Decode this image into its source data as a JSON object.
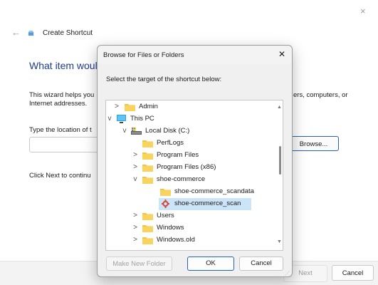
{
  "wizard": {
    "title": "Create Shortcut",
    "heading": "What item woul",
    "description_line1": "This wizard helps you",
    "description_line2": "Internet addresses.",
    "description_right": "ers, computers, or",
    "location_label": "Type the location of t",
    "location_value": "",
    "browse_label": "Browse...",
    "next_info": "Click Next to continu",
    "next_label": "Next",
    "cancel_label": "Cancel",
    "close_icon": "×",
    "back_icon": "←"
  },
  "dialog": {
    "title": "Browse for Files or Folders",
    "close_icon": "✕",
    "instruction": "Select the target of the shortcut below:",
    "tree": [
      {
        "label": "Admin",
        "chevron": ">",
        "icon": "folder-icon",
        "level": 1
      },
      {
        "label": "This PC",
        "chevron": "v",
        "icon": "computer-icon",
        "level": 0
      },
      {
        "label": "Local Disk (C:)",
        "chevron": "v",
        "icon": "drive-icon",
        "level": 1
      },
      {
        "label": "PerfLogs",
        "chevron": "",
        "icon": "folder-icon",
        "level": 2
      },
      {
        "label": "Program Files",
        "chevron": ">",
        "icon": "folder-icon",
        "level": 2
      },
      {
        "label": "Program Files (x86)",
        "chevron": ">",
        "icon": "folder-icon",
        "level": 2
      },
      {
        "label": "shoe-commerce",
        "chevron": "v",
        "icon": "folder-icon",
        "level": 2
      },
      {
        "label": "shoe-commerce_scandata",
        "chevron": "",
        "icon": "folder-icon",
        "level": 3
      },
      {
        "label": "shoe-commerce_scan",
        "chevron": "",
        "icon": "application-icon",
        "level": 3,
        "selected": true
      },
      {
        "label": "Users",
        "chevron": ">",
        "icon": "folder-icon",
        "level": 2
      },
      {
        "label": "Windows",
        "chevron": ">",
        "icon": "folder-icon",
        "level": 2
      },
      {
        "label": "Windows.old",
        "chevron": ">",
        "icon": "folder-icon",
        "level": 2
      }
    ],
    "new_folder_label": "Make New Folder",
    "ok_label": "OK",
    "cancel_label": "Cancel"
  },
  "colors": {
    "accent": "#2360c7",
    "heading": "#1e3c8c",
    "folder": "#f3c344",
    "selection": "#cce4f7"
  }
}
